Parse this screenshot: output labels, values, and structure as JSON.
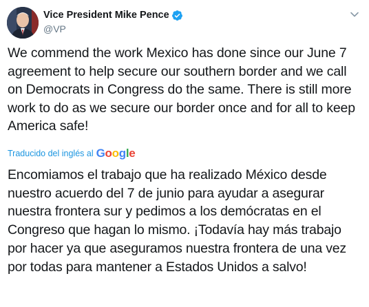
{
  "author": {
    "display_name": "Vice President Mike Pence",
    "handle": "@VP",
    "verified": true
  },
  "tweet": {
    "text": "We commend the work Mexico has done since our June 7 agreement to help secure our southern border and we call on Democrats in Congress do the same. There is still more work to do as we secure our border once and for all to keep America safe!"
  },
  "translation": {
    "label": "Traducido del inglés al",
    "provider_logo_letters": [
      "G",
      "o",
      "o",
      "g",
      "l",
      "e"
    ],
    "text": "Encomiamos el trabajo que ha realizado México desde nuestro acuerdo del 7 de junio para ayudar a asegurar nuestra frontera sur y pedimos a los demócratas en el Congreso que hagan lo mismo. ¡Todavía hay más trabajo por hacer ya que aseguramos nuestra frontera de una vez por todas para mantener a Estados Unidos a salvo!"
  },
  "icons": {
    "verified": "verified-badge-icon",
    "menu": "chevron-down-icon"
  },
  "colors": {
    "link_blue": "#1b95e0",
    "verified_blue": "#1da1f2",
    "secondary_text": "#657786",
    "google_blue": "#4285f4",
    "google_red": "#ea4335",
    "google_yellow": "#fbbc05",
    "google_green": "#34a853"
  }
}
